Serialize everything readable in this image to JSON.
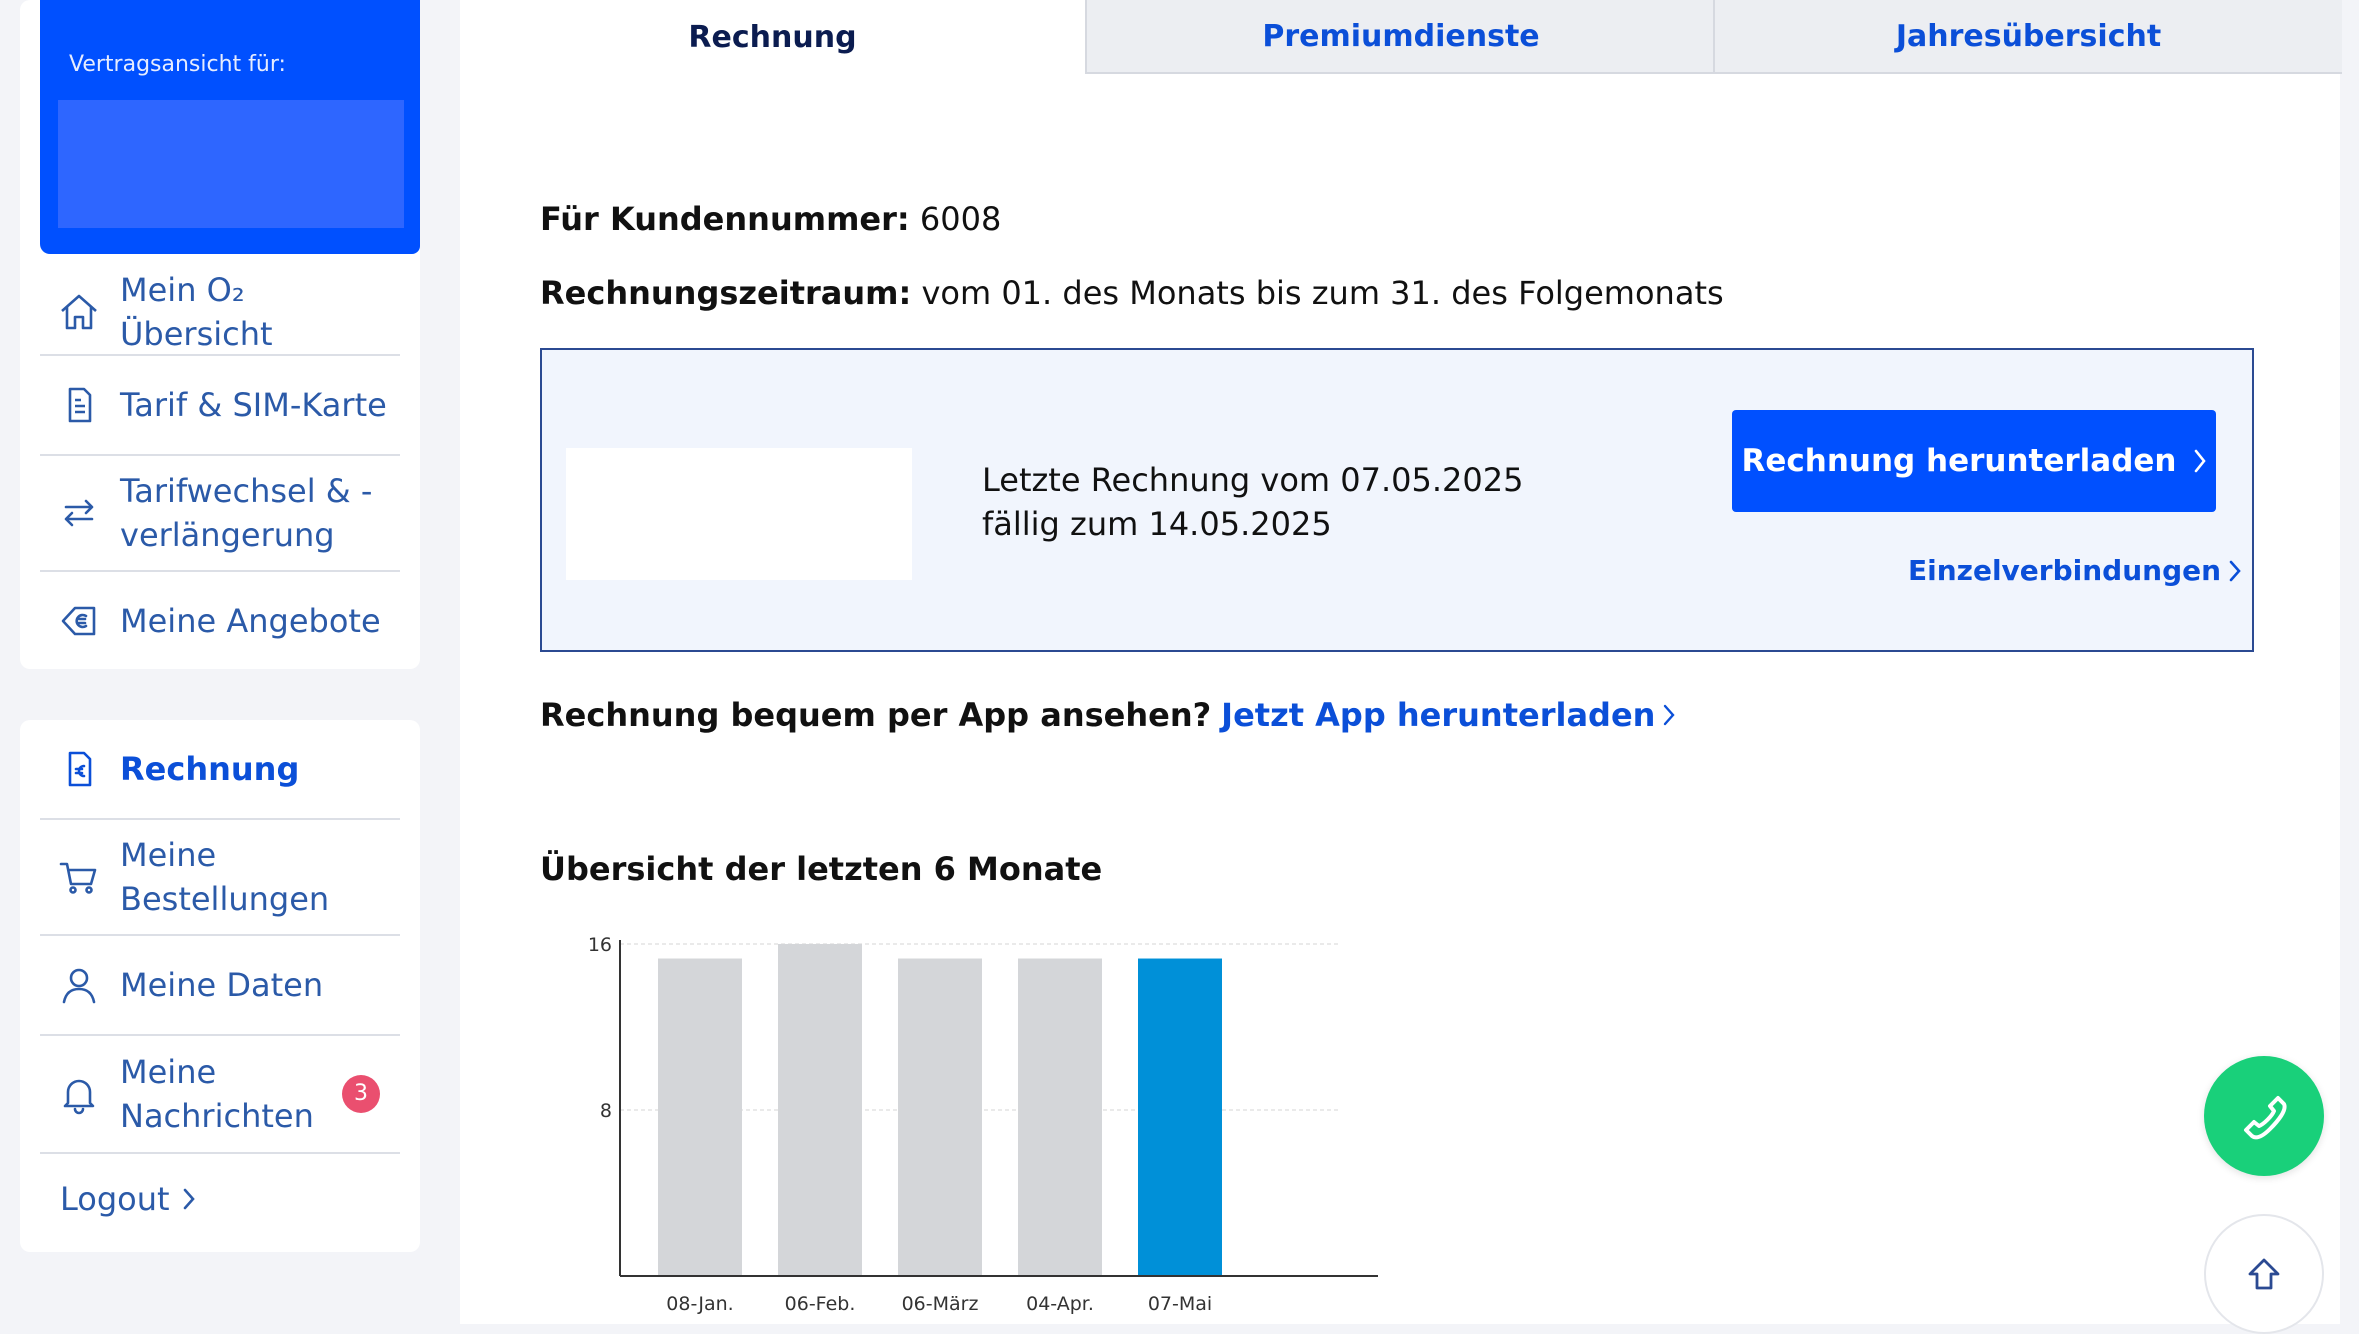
{
  "contract": {
    "label": "Vertragsansicht für:"
  },
  "sidebar": {
    "group1": [
      {
        "label": "Mein O₂ Übersicht",
        "icon": "home-icon"
      },
      {
        "label": "Tarif & SIM-Karte",
        "icon": "document-icon"
      },
      {
        "label": "Tarifwechsel & -verlängerung",
        "icon": "swap-arrows-icon"
      },
      {
        "label": "Meine Angebote",
        "icon": "euro-tag-icon"
      }
    ],
    "group2": [
      {
        "label": "Rechnung",
        "icon": "invoice-euro-icon",
        "active": true
      },
      {
        "label": "Meine Bestellungen",
        "icon": "cart-icon"
      },
      {
        "label": "Meine Daten",
        "icon": "user-icon"
      },
      {
        "label": "Meine Nachrichten",
        "icon": "bell-icon",
        "badge": "3"
      }
    ],
    "logout": "Logout"
  },
  "tabs": [
    "Rechnung",
    "Premiumdienste",
    "Jahresübersicht"
  ],
  "info": {
    "customer_label": "Für Kundennummer:",
    "customer_value": "6008",
    "period_label": "Rechnungszeitraum:",
    "period_value": "vom 01. des Monats bis zum 31. des Folgemonats"
  },
  "bill": {
    "line1": "Letzte Rechnung vom 07.05.2025",
    "line2": "fällig zum 14.05.2025",
    "download_button": "Rechnung herunterladen",
    "itemized_link": "Einzelverbindungen"
  },
  "app_promo": {
    "question": "Rechnung bequem per App ansehen?",
    "link": "Jetzt App herunterladen"
  },
  "chart_title": "Übersicht der letzten 6 Monate",
  "chart_data": {
    "type": "bar",
    "categories": [
      "08-Jan.",
      "06-Feb.",
      "06-März",
      "04-Apr.",
      "07-Mai"
    ],
    "values": [
      15.3,
      16,
      15.3,
      15.3,
      15.3
    ],
    "ylim": [
      0,
      16
    ],
    "yticks": [
      8,
      16
    ],
    "colors": {
      "default": "#d4d6d9",
      "highlight": "#0090d8"
    },
    "highlight_index": 4,
    "grid": true
  },
  "colors": {
    "brand_blue": "#0050ff",
    "link_blue": "#0b4fd8",
    "call_green": "#19d07a",
    "badge_red": "#ea4f6f"
  }
}
